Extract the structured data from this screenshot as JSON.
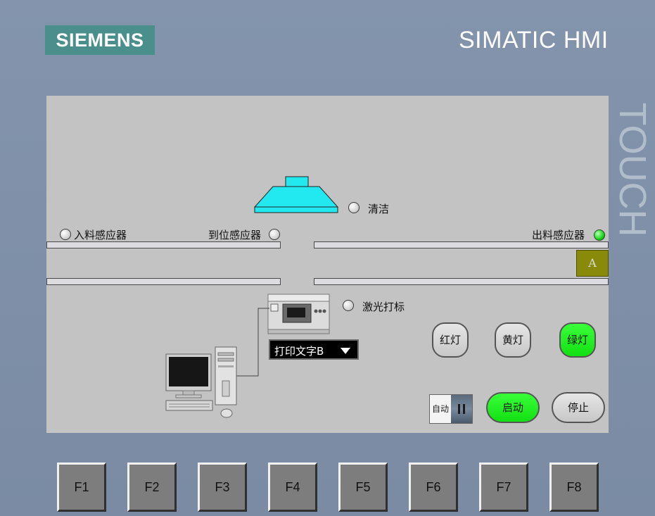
{
  "header": {
    "logo": "SIEMENS",
    "brand": "SIMATIC HMI",
    "touch": "TOUCH"
  },
  "process": {
    "clean_label": "清洁",
    "infeed_sensor": "入料感应器",
    "position_sensor": "到位感应器",
    "outfeed_sensor": "出料感应器",
    "product_label": "A",
    "laser_label": "激光打标",
    "print_select": "打印文字B"
  },
  "lamps": {
    "clean": false,
    "infeed": false,
    "position": false,
    "outfeed": true,
    "laser": false
  },
  "buttons": {
    "red_light": "红灯",
    "yellow_light": "黄灯",
    "green_light": "绿灯",
    "mode_switch": "自动",
    "start": "启动",
    "stop": "停止"
  },
  "colors": {
    "active_green": "#19e519",
    "lamp_on": "#19d419",
    "logo_bg": "#4a8f8c",
    "product_box": "#8a8a0a"
  },
  "fkeys": [
    "F1",
    "F2",
    "F3",
    "F4",
    "F5",
    "F6",
    "F7",
    "F8"
  ]
}
